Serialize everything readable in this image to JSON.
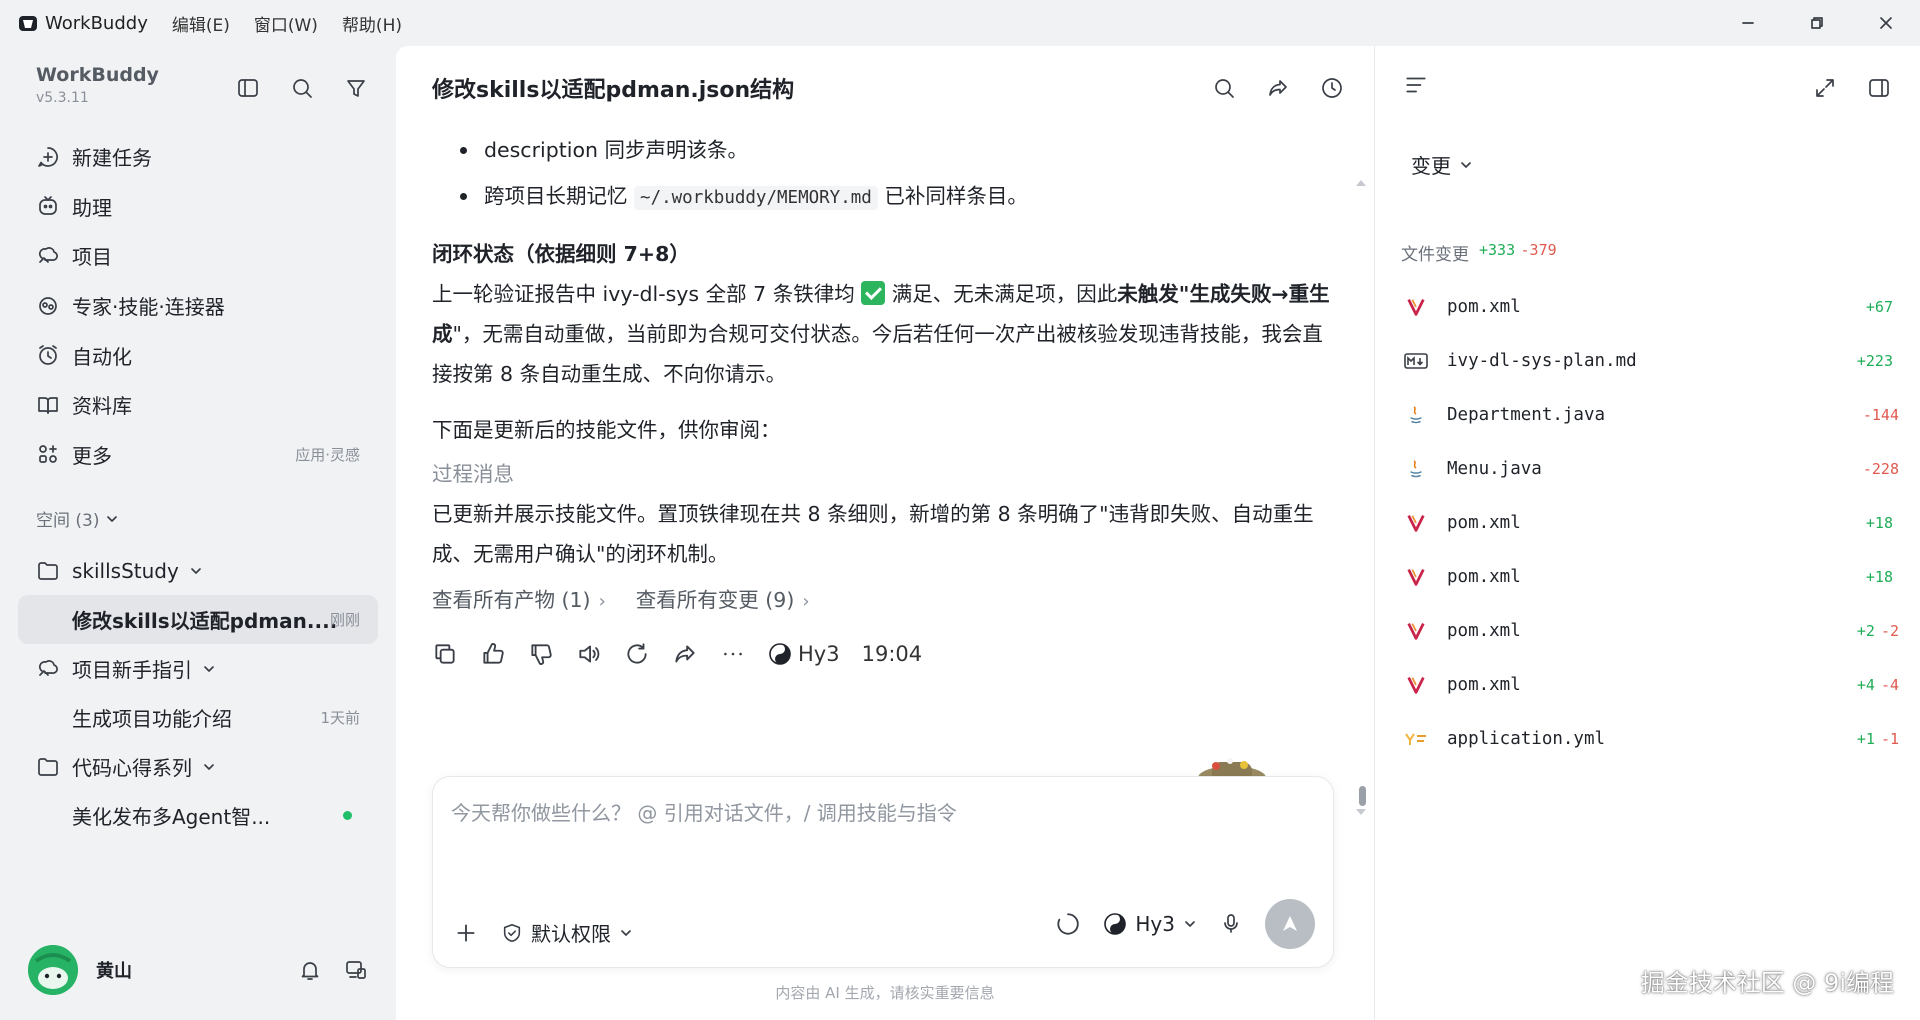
{
  "titlebar": {
    "app_name": "WorkBuddy",
    "menus": [
      "编辑(E)",
      "窗口(W)",
      "帮助(H)"
    ]
  },
  "sidebar": {
    "brand": "WorkBuddy",
    "version": "v5.3.11",
    "nav": [
      {
        "label": "新建任务",
        "icon": "new-task-icon"
      },
      {
        "label": "助理",
        "icon": "assistant-icon"
      },
      {
        "label": "项目",
        "icon": "project-icon"
      },
      {
        "label": "专家·技能·连接器",
        "icon": "expert-icon"
      },
      {
        "label": "自动化",
        "icon": "automation-icon"
      },
      {
        "label": "资料库",
        "icon": "library-icon"
      },
      {
        "label": "更多",
        "icon": "more-icon",
        "hint": "应用·灵感"
      }
    ],
    "spaces_label": "空间 (3)",
    "tree": [
      {
        "label": "skillsStudy",
        "type": "folder"
      },
      {
        "label": "修改skills以适配pdman....",
        "type": "task",
        "meta": "刚刚",
        "active": true
      },
      {
        "label": "项目新手指引",
        "type": "project"
      },
      {
        "label": "生成项目功能介绍",
        "type": "task",
        "meta": "1天前"
      },
      {
        "label": "代码心得系列",
        "type": "folder"
      },
      {
        "label": "美化发布多Agent智...",
        "type": "task",
        "dot": true
      }
    ],
    "user": {
      "name": "黄山"
    }
  },
  "chat": {
    "title": "修改skills以适配pdman.json结构",
    "bullets": [
      {
        "before": "description 同步声明该条。",
        "code": "",
        "after": ""
      },
      {
        "before": "跨项目长期记忆 ",
        "code": "~/.workbuddy/MEMORY.md",
        "after": " 已补同样条目。"
      }
    ],
    "section_title": "闭环状态（依据细则 7+8）",
    "para1": {
      "p1": "上一轮验证报告中 ivy-dl-sys 全部 7 条铁律均 ",
      "p2": " 满足、无未满足项，因此",
      "b1": "未触发",
      "p3": "\"",
      "b2": "生成失败→重生成",
      "p4": "\"，无需自动重做，当前即为合规可交付状态。今后若任何一次产出被核验发现违背技能，我会直接按第 8 条自动重生成、不向你请示。"
    },
    "para2": "下面是更新后的技能文件，供你审阅：",
    "process_label": "过程消息",
    "para3": "已更新并展示技能文件。置顶铁律现在共 8 条细则，新增的第 8 条明确了\"违背即失败、自动重生成、无需用户确认\"的闭环机制。",
    "link_artifacts": "查看所有产物 (1)",
    "link_changes": "查看所有变更 (9)",
    "model": "Hy3",
    "time": "19:04",
    "composer": {
      "placeholder": "今天帮你做些什么？ @ 引用对话文件，/ 调用技能与指令",
      "permission": "默认权限",
      "model": "Hy3"
    },
    "disclaimer": "内容由 AI 生成，请核实重要信息"
  },
  "panel": {
    "changes_label": "变更",
    "file_changes_label": "文件变更",
    "total_plus": "+333",
    "total_minus": "-379",
    "files": [
      {
        "name": "pom.xml",
        "icon": "maven-icon",
        "plus": "+67",
        "minus": ""
      },
      {
        "name": "ivy-dl-sys-plan.md",
        "icon": "markdown-icon",
        "plus": "+223",
        "minus": ""
      },
      {
        "name": "Department.java",
        "icon": "java-icon",
        "plus": "",
        "minus": "-144"
      },
      {
        "name": "Menu.java",
        "icon": "java-icon",
        "plus": "",
        "minus": "-228"
      },
      {
        "name": "pom.xml",
        "icon": "maven-icon",
        "plus": "+18",
        "minus": ""
      },
      {
        "name": "pom.xml",
        "icon": "maven-icon",
        "plus": "+18",
        "minus": ""
      },
      {
        "name": "pom.xml",
        "icon": "maven-icon",
        "plus": "+2",
        "minus": "-2"
      },
      {
        "name": "pom.xml",
        "icon": "maven-icon",
        "plus": "+4",
        "minus": "-4"
      },
      {
        "name": "application.yml",
        "icon": "yaml-icon",
        "plus": "+1",
        "minus": "-1"
      }
    ]
  },
  "watermark": "掘金技术社区 @ 9i编程",
  "colors": {
    "accent_green": "#1fae57",
    "delete_red": "#e05a4f",
    "active_bg": "#e3e5e9"
  }
}
